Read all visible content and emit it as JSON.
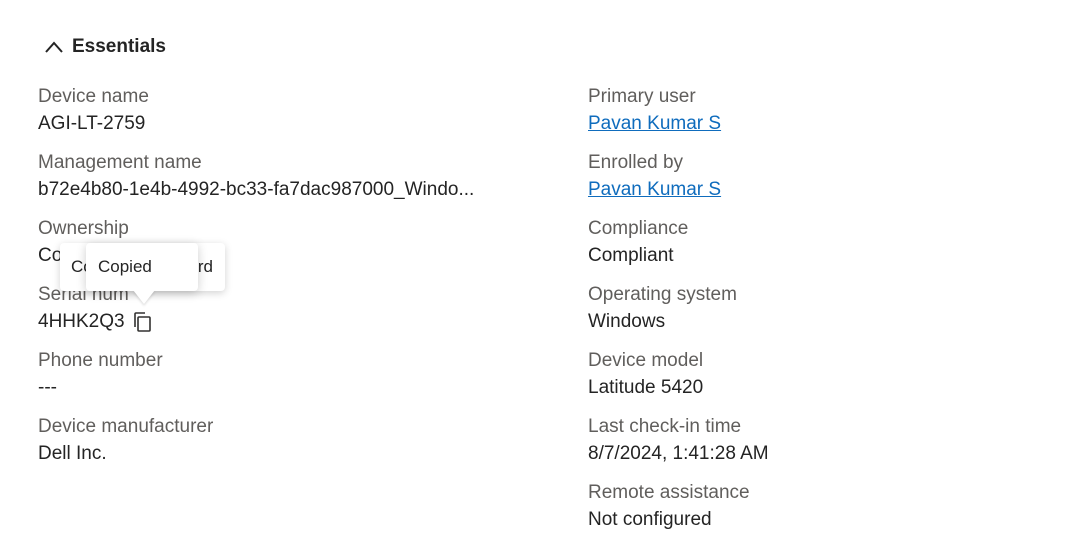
{
  "section": {
    "title": "Essentials",
    "expanded_icon": "chevron-up-icon"
  },
  "left_fields": {
    "device_name": {
      "label": "Device name",
      "value": "AGI-LT-2759"
    },
    "management_name": {
      "label": "Management name",
      "value": "b72e4b80-1e4b-4992-bc33-fa7dac987000_Windo..."
    },
    "ownership": {
      "label": "Ownership",
      "value_visible": "Co"
    },
    "serial_number": {
      "label_visible": "Serial num",
      "value": "4HHK2Q3",
      "copy_icon": "copy-icon"
    },
    "phone_number": {
      "label": "Phone number",
      "value": "---"
    },
    "device_manufacturer": {
      "label": "Device manufacturer",
      "value": "Dell Inc."
    }
  },
  "right_fields": {
    "primary_user": {
      "label": "Primary user",
      "value": "Pavan Kumar S"
    },
    "enrolled_by": {
      "label": "Enrolled by",
      "value": "Pavan Kumar S"
    },
    "compliance": {
      "label": "Compliance",
      "value": "Compliant"
    },
    "operating_system": {
      "label": "Operating system",
      "value": "Windows"
    },
    "device_model": {
      "label": "Device model",
      "value": "Latitude 5420"
    },
    "last_checkin": {
      "label": "Last check-in time",
      "value": "8/7/2024, 1:41:28 AM"
    },
    "remote_assistance": {
      "label": "Remote assistance",
      "value": "Not configured"
    }
  },
  "tooltips": {
    "back_left_fragment": "Co",
    "back_right_fragment": "rd",
    "front_text": "Copied"
  },
  "colors": {
    "link": "#0f6cbd",
    "label": "#605e5c",
    "text": "#242424"
  }
}
